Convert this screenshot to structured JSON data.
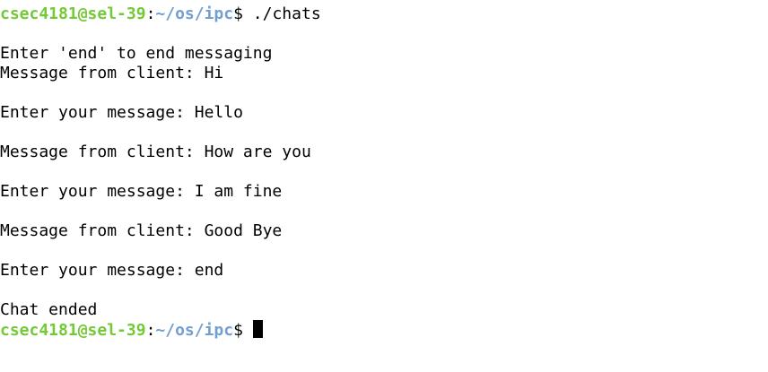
{
  "prompt": {
    "user_host": "csec4181@sel-39",
    "separator": ":",
    "path": "~/os/ipc",
    "symbol": "$ "
  },
  "command": "./chats",
  "output": [
    "",
    "Enter 'end' to end messaging",
    "Message from client: Hi",
    "",
    "Enter your message: Hello",
    "",
    "Message from client: How are you",
    "",
    "Enter your message: I am fine",
    "",
    "Message from client: Good Bye",
    "",
    "Enter your message: end",
    "",
    "Chat ended"
  ],
  "colors": {
    "user_host": "#73c936",
    "path": "#729fcf",
    "text": "#000000",
    "background": "#ffffff"
  }
}
